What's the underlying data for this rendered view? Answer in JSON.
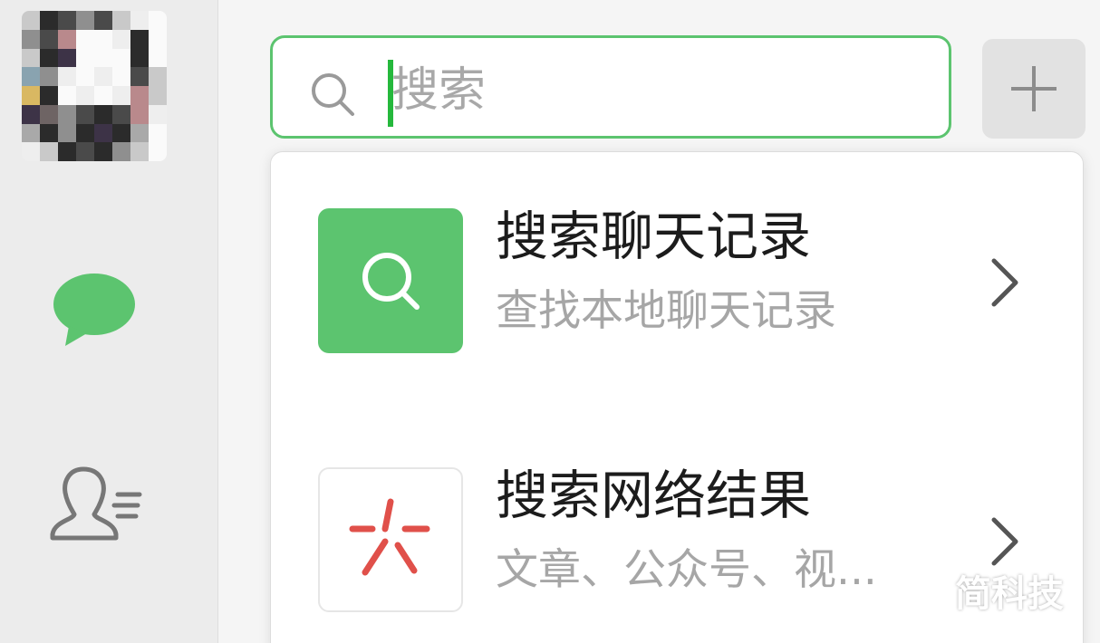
{
  "search": {
    "placeholder": "搜索",
    "accent_color": "#5cc46f"
  },
  "sidebar": {
    "icons": [
      "avatar",
      "chat-bubble-icon",
      "contacts-icon"
    ],
    "active_color": "#5cc46f"
  },
  "toolbar": {
    "add_icon": "plus-icon"
  },
  "results": [
    {
      "icon": "search-icon",
      "title": "搜索聊天记录",
      "subtitle": "查找本地聊天记录"
    },
    {
      "icon": "network-search-icon",
      "title": "搜索网络结果",
      "subtitle": "文章、公众号、视..."
    }
  ],
  "watermark": "简科技"
}
